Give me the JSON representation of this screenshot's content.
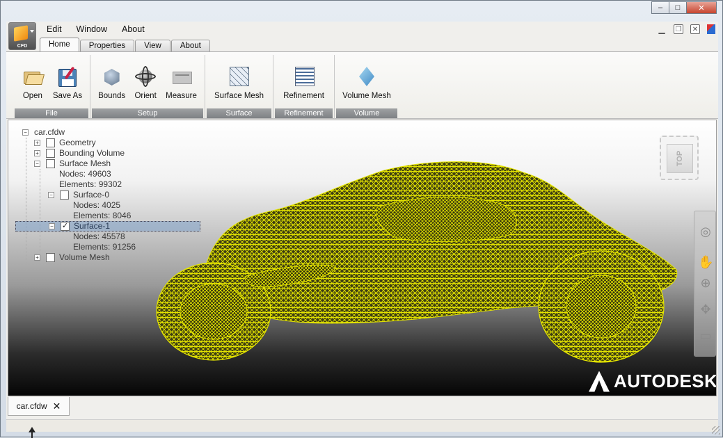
{
  "window": {
    "controls": [
      "–",
      "□",
      "✕"
    ]
  },
  "app_button": {
    "label": "CFD"
  },
  "menu": [
    "Edit",
    "Window",
    "About"
  ],
  "ribbon_tabs": [
    {
      "label": "Home",
      "active": true
    },
    {
      "label": "Properties",
      "active": false
    },
    {
      "label": "View",
      "active": false
    },
    {
      "label": "About",
      "active": false
    }
  ],
  "ribbon": {
    "file": {
      "label": "File",
      "open": "Open",
      "save_as": "Save As"
    },
    "setup": {
      "label": "Setup",
      "bounds": "Bounds",
      "orient": "Orient",
      "measure": "Measure"
    },
    "surface": {
      "label": "Surface",
      "surface_mesh": "Surface Mesh"
    },
    "refinement": {
      "label": "Refinement",
      "refinement": "Refinement"
    },
    "volume": {
      "label": "Volume",
      "volume_mesh": "Volume Mesh"
    }
  },
  "tree": {
    "root": "car.cfdw",
    "geometry": "Geometry",
    "bounding_volume": "Bounding Volume",
    "surface_mesh": "Surface Mesh",
    "sm_nodes": "Nodes: 49603",
    "sm_elements": "Elements: 99302",
    "surface0": "Surface-0",
    "s0_nodes": "Nodes: 4025",
    "s0_elements": "Elements: 8046",
    "surface1": "Surface-1",
    "s1_nodes": "Nodes: 45578",
    "s1_elements": "Elements: 91256",
    "volume_mesh": "Volume Mesh"
  },
  "viewcube": {
    "face": "TOP"
  },
  "brand": "AUTODESK.",
  "doc_tab": {
    "label": "car.cfdw",
    "close": "✕"
  },
  "colors": {
    "mesh": "#e8e800",
    "mesh_fill": "#3a3a10"
  }
}
